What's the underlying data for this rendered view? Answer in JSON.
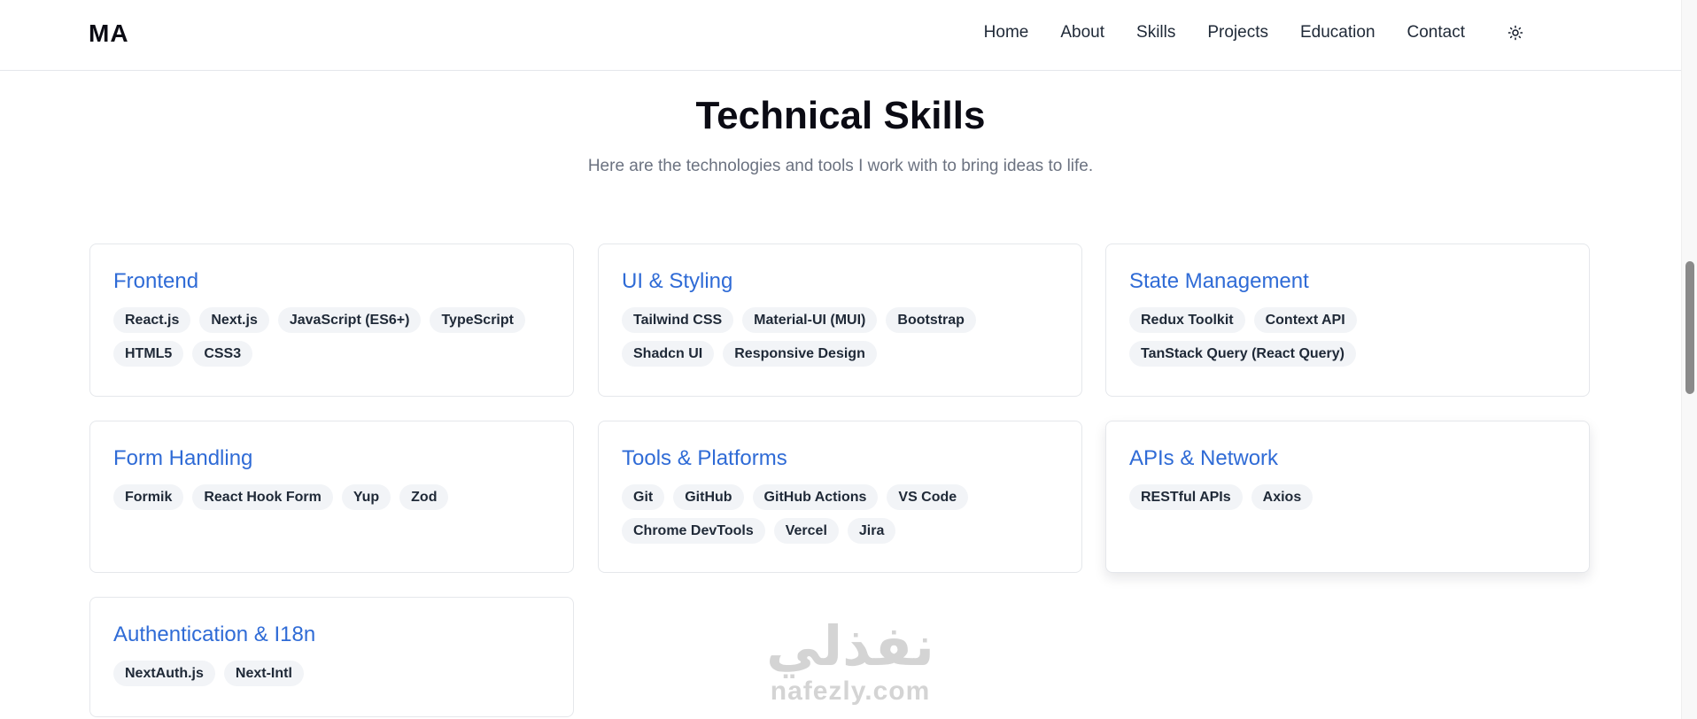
{
  "header": {
    "logo": "MA",
    "nav": [
      "Home",
      "About",
      "Skills",
      "Projects",
      "Education",
      "Contact"
    ],
    "theme_icon": "sun-icon"
  },
  "section": {
    "title": "Technical Skills",
    "subtitle": "Here are the technologies and tools I work with to bring ideas to life."
  },
  "cards": [
    {
      "title": "Frontend",
      "tags": [
        "React.js",
        "Next.js",
        "JavaScript (ES6+)",
        "TypeScript",
        "HTML5",
        "CSS3"
      ]
    },
    {
      "title": "UI & Styling",
      "tags": [
        "Tailwind CSS",
        "Material-UI (MUI)",
        "Bootstrap",
        "Shadcn UI",
        "Responsive Design"
      ]
    },
    {
      "title": "State Management",
      "tags": [
        "Redux Toolkit",
        "Context API",
        "TanStack Query (React Query)"
      ]
    },
    {
      "title": "Form Handling",
      "tags": [
        "Formik",
        "React Hook Form",
        "Yup",
        "Zod"
      ]
    },
    {
      "title": "Tools & Platforms",
      "tags": [
        "Git",
        "GitHub",
        "GitHub Actions",
        "VS Code",
        "Chrome DevTools",
        "Vercel",
        "Jira"
      ]
    },
    {
      "title": "APIs & Network",
      "tags": [
        "RESTful APIs",
        "Axios"
      ]
    },
    {
      "title": "Authentication & I18n",
      "tags": [
        "NextAuth.js",
        "Next-Intl"
      ]
    }
  ],
  "watermark": {
    "arabic": "نفذلي",
    "latin": "nafezly.com"
  },
  "colors": {
    "accent": "#2f6bd6",
    "tag_bg": "#f2f4f7",
    "text": "#0b0b14",
    "muted": "#6b7280"
  }
}
